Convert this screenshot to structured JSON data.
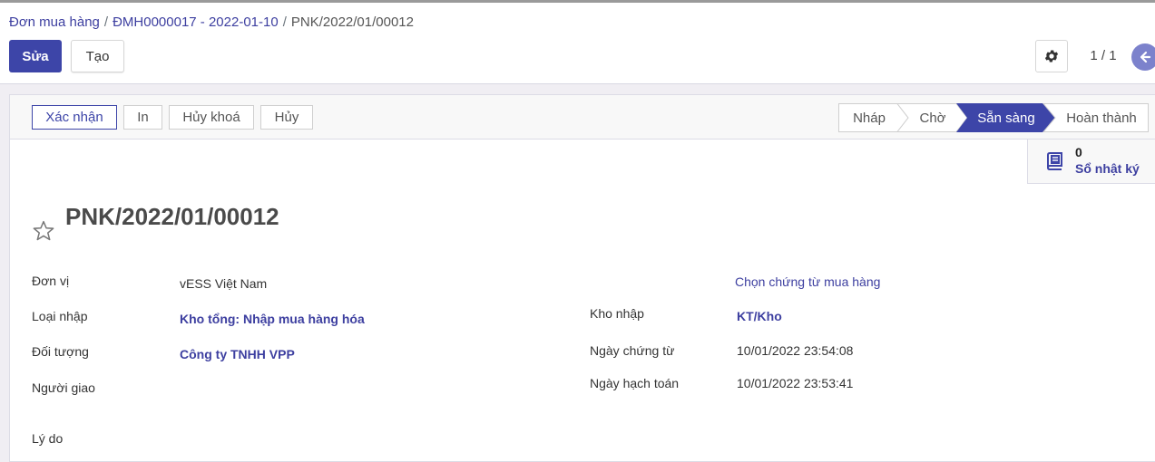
{
  "breadcrumb": {
    "items": [
      "Đơn mua hàng",
      "ĐMH0000017 - 2022-01-10"
    ],
    "current": "PNK/2022/01/00012",
    "separator": "/"
  },
  "toolbar": {
    "edit_label": "Sửa",
    "create_label": "Tạo",
    "pager": "1 / 1"
  },
  "statusbar": {
    "actions": [
      "Xác nhận",
      "In",
      "Hủy khoá",
      "Hủy"
    ],
    "stages": [
      "Nháp",
      "Chờ",
      "Sẵn sàng",
      "Hoàn thành"
    ],
    "active_stage": "Sẵn sàng"
  },
  "smart_button": {
    "count": "0",
    "label": "Sổ nhật ký"
  },
  "record": {
    "title": "PNK/2022/01/00012",
    "left_fields": [
      {
        "label": "Đơn vị",
        "value": "vESS Việt Nam"
      },
      {
        "label": "Loại nhập",
        "value": "Kho tổng: Nhập mua hàng hóa"
      },
      {
        "label": "Đối tượng",
        "value": "Công ty TNHH VPP"
      },
      {
        "label": "Người giao",
        "value": ""
      },
      {
        "label": "Lý do",
        "value": ""
      }
    ],
    "select_link": "Chọn chứng từ mua hàng",
    "right_fields": [
      {
        "label": "Kho nhập",
        "value": "KT/Kho"
      },
      {
        "label": "Ngày chứng từ",
        "value": "10/01/2022 23:54:08"
      },
      {
        "label": "Ngày hạch toán",
        "value": "10/01/2022 23:53:41"
      }
    ]
  },
  "colors": {
    "primary": "#3d45a8",
    "link": "#3d3fa0",
    "background": "#f0eef3",
    "pager_button": "#7c82cc"
  },
  "icons": [
    "gear-icon",
    "arrow-left-icon",
    "book-icon",
    "star-icon"
  ]
}
